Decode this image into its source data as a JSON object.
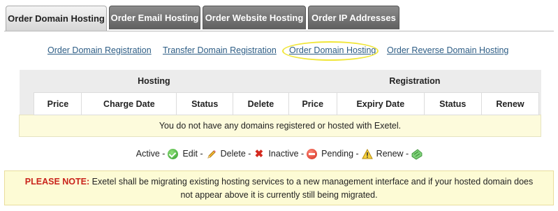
{
  "tabs": [
    {
      "label": "Order Domain Hosting",
      "active": true
    },
    {
      "label": "Order Email Hosting",
      "active": false
    },
    {
      "label": "Order Website Hosting",
      "active": false
    },
    {
      "label": "Order IP Addresses",
      "active": false
    }
  ],
  "subnav": [
    {
      "label": "Order Domain Registration"
    },
    {
      "label": "Transfer Domain Registration"
    },
    {
      "label": "Order Domain Hosting",
      "highlighted": true
    },
    {
      "label": "Order Reverse Domain Hosting"
    }
  ],
  "table": {
    "groups": {
      "hosting": "Hosting",
      "registration": "Registration"
    },
    "columns": [
      "Price",
      "Charge Date",
      "Status",
      "Delete",
      "Price",
      "Expiry Date",
      "Status",
      "Renew"
    ],
    "empty_message": "You do not have any domains registered or hosted with Exetel."
  },
  "legend": [
    {
      "label": "Active -",
      "icon": "green-check-icon"
    },
    {
      "label": "Edit -",
      "icon": "pencil-icon"
    },
    {
      "label": "Delete -",
      "icon": "red-x-icon"
    },
    {
      "label": "Inactive -",
      "icon": "red-minus-icon"
    },
    {
      "label": "Pending -",
      "icon": "warning-triangle-icon"
    },
    {
      "label": "Renew -",
      "icon": "renew-arrow-icon"
    }
  ],
  "note": {
    "label": "PLEASE NOTE:",
    "text": "Exetel shall be migrating existing hosting services to a new management interface and if your hosted domain does not appear above it is currently still being migrated."
  },
  "colors": {
    "link": "#2d5d85",
    "note_label": "#c9231b",
    "highlight_ring": "#f0e63a",
    "message_bg": "#fdfbdc"
  }
}
